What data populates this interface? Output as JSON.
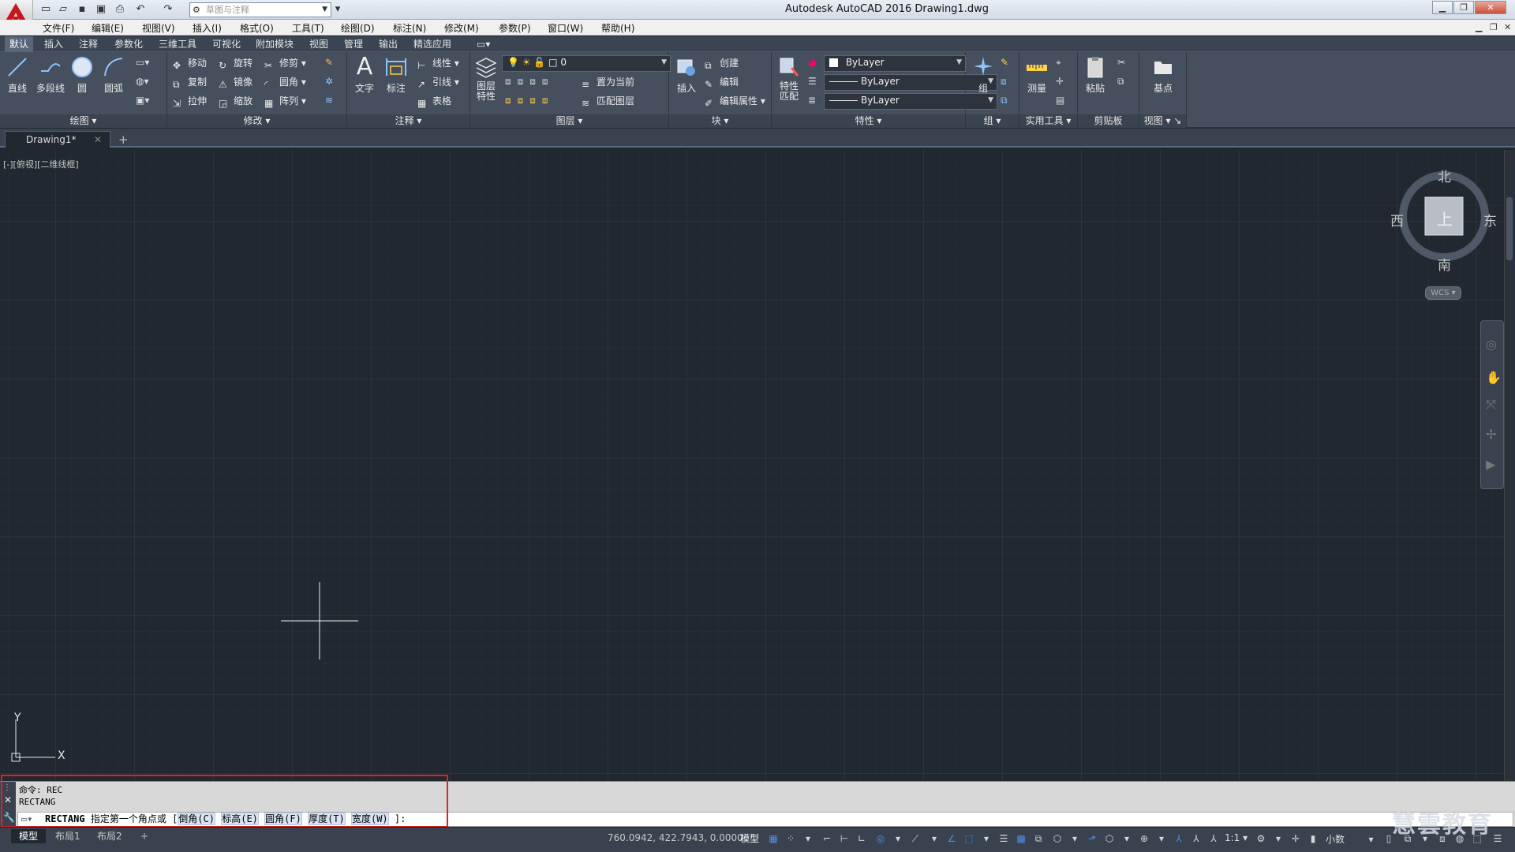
{
  "app": {
    "title": "Autodesk AutoCAD 2016    Drawing1.dwg",
    "logo_letter": "A",
    "workspace_placeholder": "草图与注释"
  },
  "menu": [
    "文件(F)",
    "编辑(E)",
    "视图(V)",
    "插入(I)",
    "格式(O)",
    "工具(T)",
    "绘图(D)",
    "标注(N)",
    "修改(M)",
    "参数(P)",
    "窗口(W)",
    "帮助(H)"
  ],
  "ribbon_tabs": [
    "默认",
    "插入",
    "注释",
    "参数化",
    "三维工具",
    "可视化",
    "附加模块",
    "视图",
    "管理",
    "输出",
    "精选应用"
  ],
  "panels": {
    "draw": {
      "title": "绘图",
      "tools": [
        "直线",
        "多段线",
        "圆",
        "圆弧"
      ]
    },
    "modify": {
      "title": "修改",
      "tools": [
        "移动",
        "旋转",
        "修剪",
        "复制",
        "镜像",
        "圆角",
        "拉伸",
        "缩放",
        "阵列"
      ]
    },
    "annotation": {
      "title": "注释",
      "big": [
        "文字",
        "标注"
      ],
      "small": [
        "线性",
        "引线",
        "表格"
      ]
    },
    "layers": {
      "title": "图层",
      "big": "图层\n特性",
      "layer_value": "0",
      "small": [
        "置为当前",
        "匹配图层"
      ]
    },
    "block": {
      "title": "块",
      "big": "插入",
      "small": [
        "创建",
        "编辑",
        "编辑属性"
      ]
    },
    "properties": {
      "title": "特性",
      "big": "特性\n匹配",
      "color": "ByLayer",
      "linetype": "ByLayer",
      "lineweight": "ByLayer"
    },
    "groups": {
      "title": "组",
      "big": "组"
    },
    "utilities": {
      "title": "实用工具",
      "big": "测量"
    },
    "clipboard": {
      "title": "剪贴板",
      "big": "粘贴"
    },
    "view": {
      "title": "视图",
      "big": "基点"
    }
  },
  "document_tab": "Drawing1*",
  "viewport_label": "[-][俯视][二维线框]",
  "viewcube": {
    "north": "北",
    "south": "南",
    "east": "东",
    "west": "西",
    "top_face": "上",
    "wcs": "WCS"
  },
  "ucs": {
    "x": "X",
    "y": "Y"
  },
  "command": {
    "history": [
      "命令: REC",
      "RECTANG"
    ],
    "prompt_cmd": "RECTANG",
    "prompt_text": "指定第一个角点或",
    "options": [
      "倒角(C)",
      "标高(E)",
      "圆角(F)",
      "厚度(T)",
      "宽度(W)"
    ],
    "suffix": "]:"
  },
  "layout_tabs": [
    "模型",
    "布局1",
    "布局2"
  ],
  "status": {
    "coords": "760.0942, 422.7943, 0.0000",
    "model": "模型",
    "scale": "1:1",
    "units": "小数"
  },
  "watermark": "慧雲教育"
}
